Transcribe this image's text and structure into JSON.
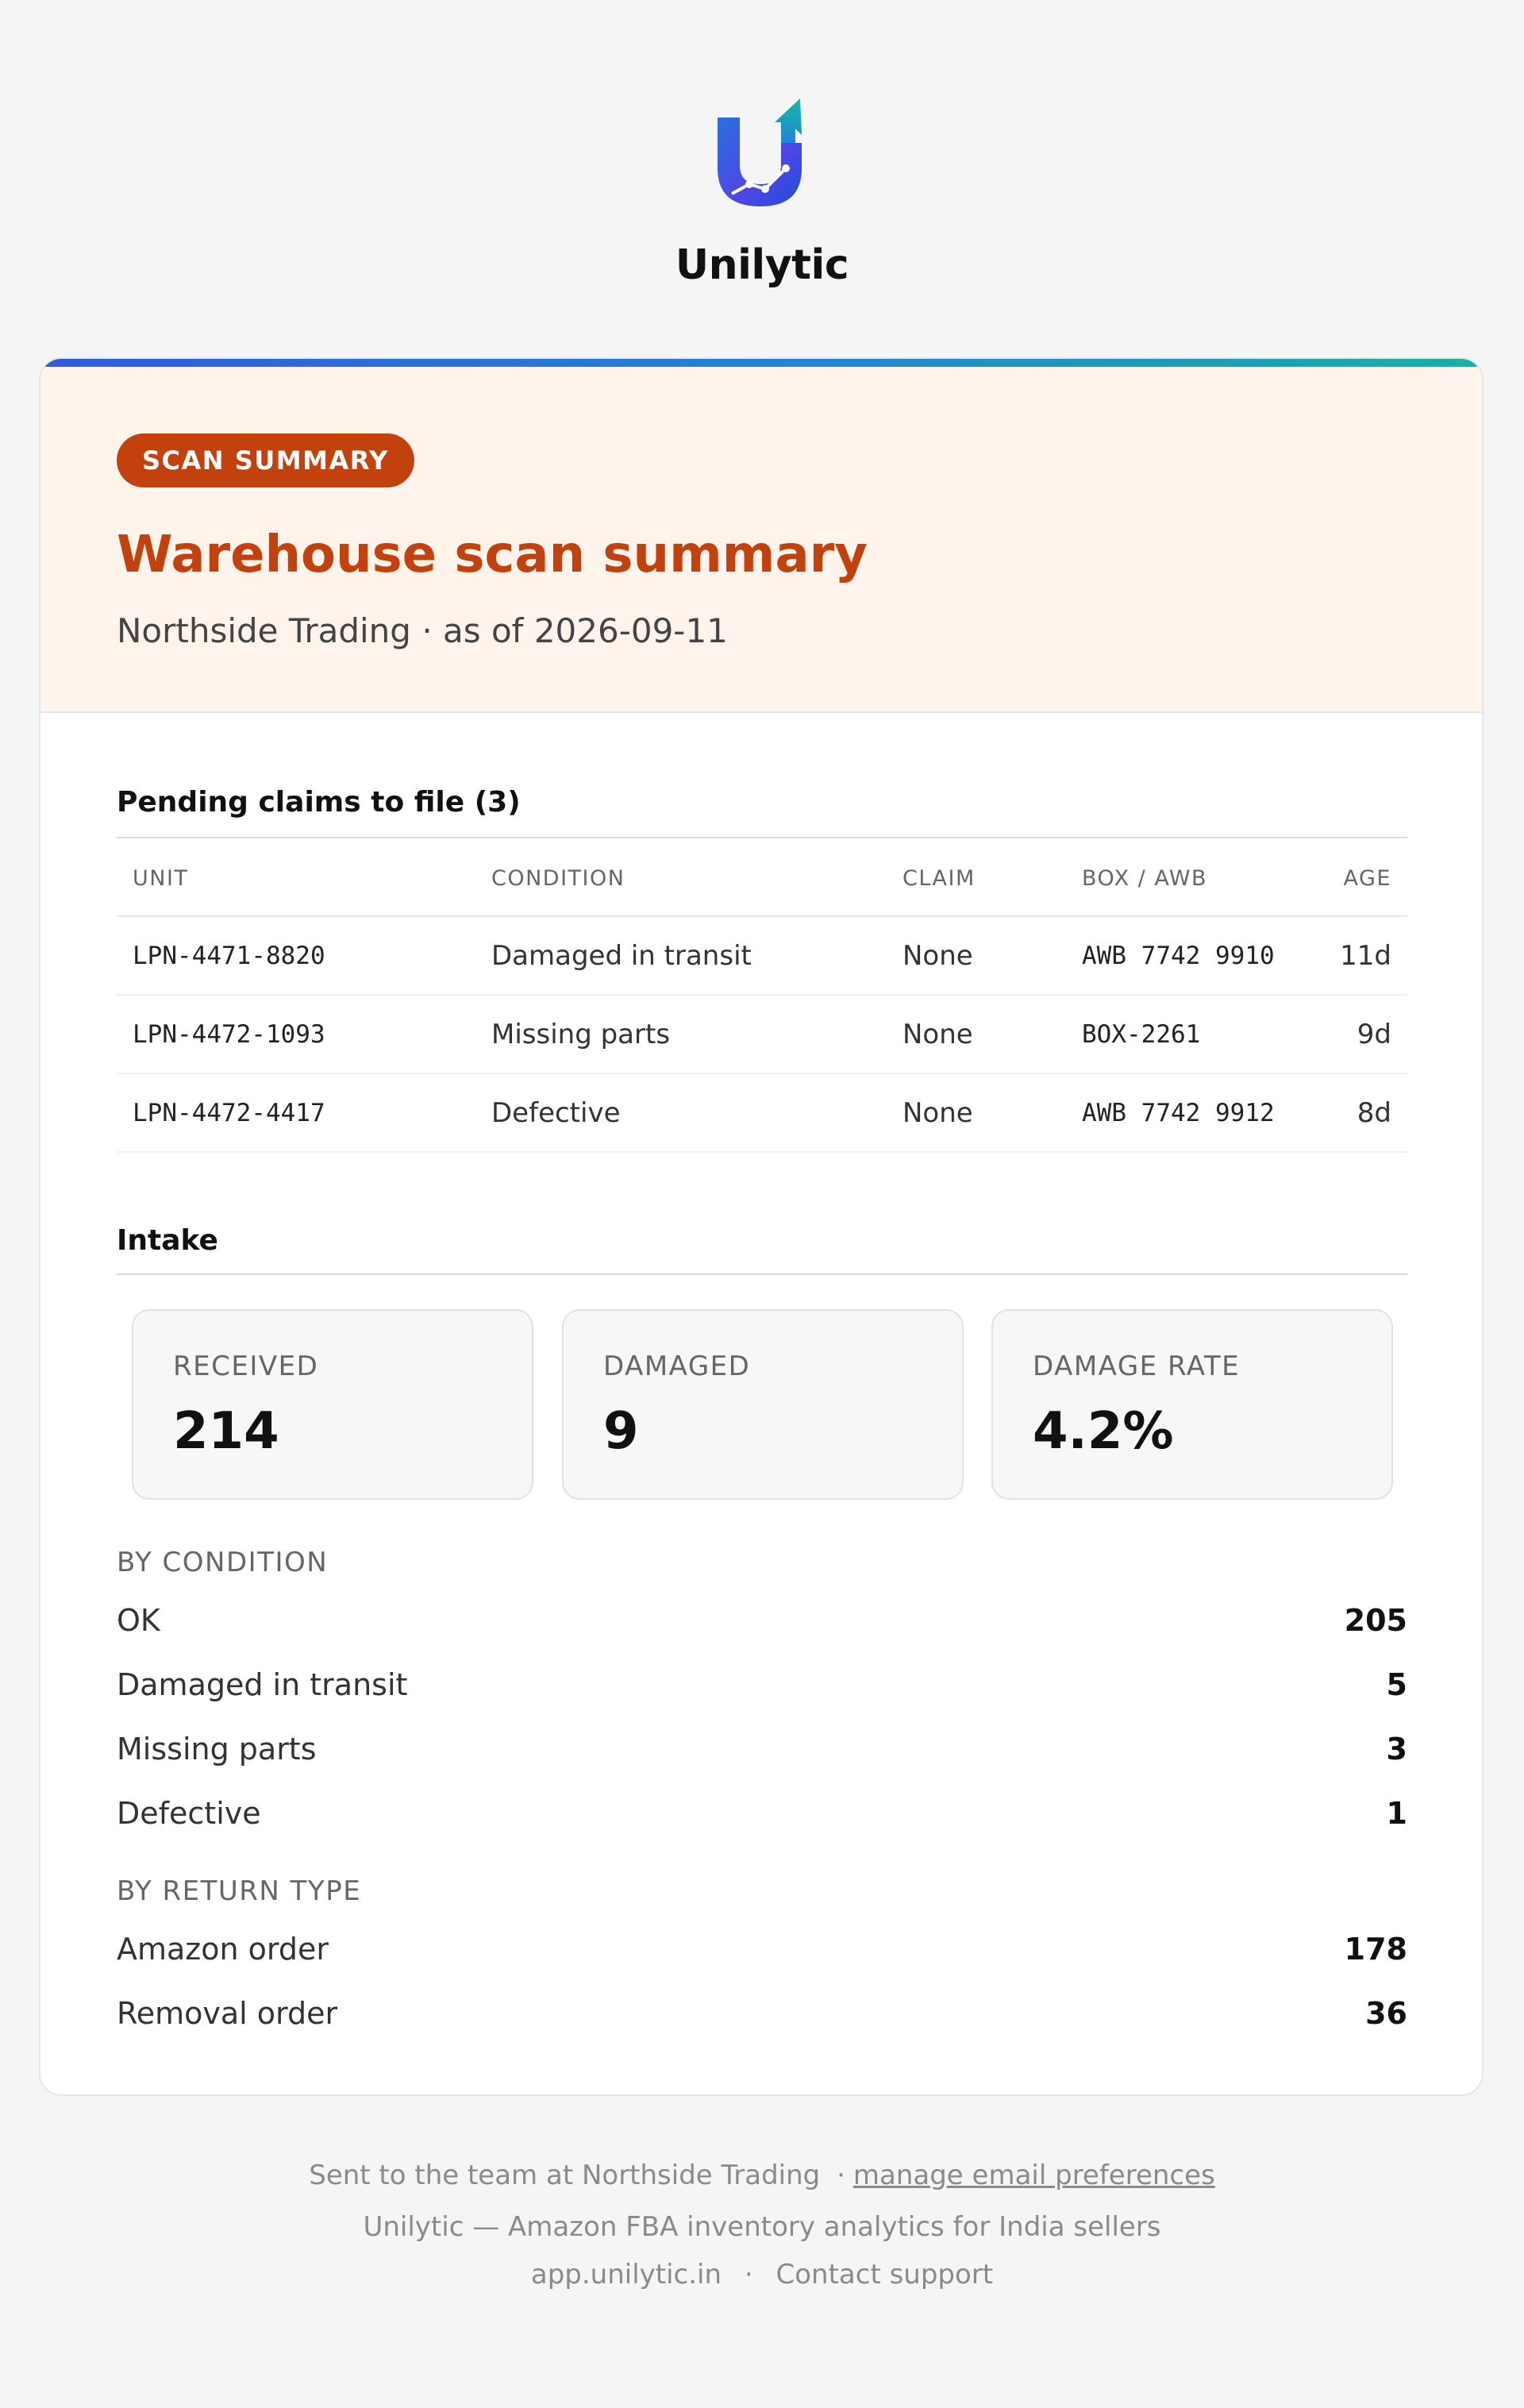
{
  "brand": {
    "name": "Unilytic"
  },
  "hero": {
    "badge": "SCAN SUMMARY",
    "title": "Warehouse scan summary",
    "subtitle": "Northside Trading · as of 2026-09-11"
  },
  "claims": {
    "title": "Pending claims to file (3)",
    "columns": [
      "UNIT",
      "CONDITION",
      "CLAIM",
      "BOX / AWB",
      "AGE"
    ],
    "rows": [
      {
        "unit": "LPN-4471-8820",
        "condition": "Damaged in transit",
        "claim": "None",
        "box": "AWB 7742 9910",
        "age": "11d"
      },
      {
        "unit": "LPN-4472-1093",
        "condition": "Missing parts",
        "claim": "None",
        "box": "BOX-2261",
        "age": "9d"
      },
      {
        "unit": "LPN-4472-4417",
        "condition": "Defective",
        "claim": "None",
        "box": "AWB 7742 9912",
        "age": "8d"
      }
    ]
  },
  "intake": {
    "title": "Intake",
    "stats": [
      {
        "label": "RECEIVED",
        "value": "214"
      },
      {
        "label": "DAMAGED",
        "value": "9"
      },
      {
        "label": "DAMAGE RATE",
        "value": "4.2%"
      }
    ],
    "by_condition": {
      "label": "BY CONDITION",
      "items": [
        {
          "name": "OK",
          "count": "205"
        },
        {
          "name": "Damaged in transit",
          "count": "5"
        },
        {
          "name": "Missing parts",
          "count": "3"
        },
        {
          "name": "Defective",
          "count": "1"
        }
      ]
    },
    "by_return_type": {
      "label": "BY RETURN TYPE",
      "items": [
        {
          "name": "Amazon order",
          "count": "178"
        },
        {
          "name": "Removal order",
          "count": "36"
        }
      ]
    }
  },
  "footer": {
    "sent_to": "Sent to the team at Northside Trading",
    "separator": "·",
    "manage_link": "manage email preferences",
    "tagline": "Unilytic — Amazon FBA inventory analytics for India sellers",
    "app_link": "app.unilytic.in",
    "contact_link": "Contact support"
  },
  "colors": {
    "accent": "#c2410c",
    "hero_bg": "#fff4ec",
    "gradient_start": "#2d5be3",
    "gradient_end": "#12b3a2"
  }
}
